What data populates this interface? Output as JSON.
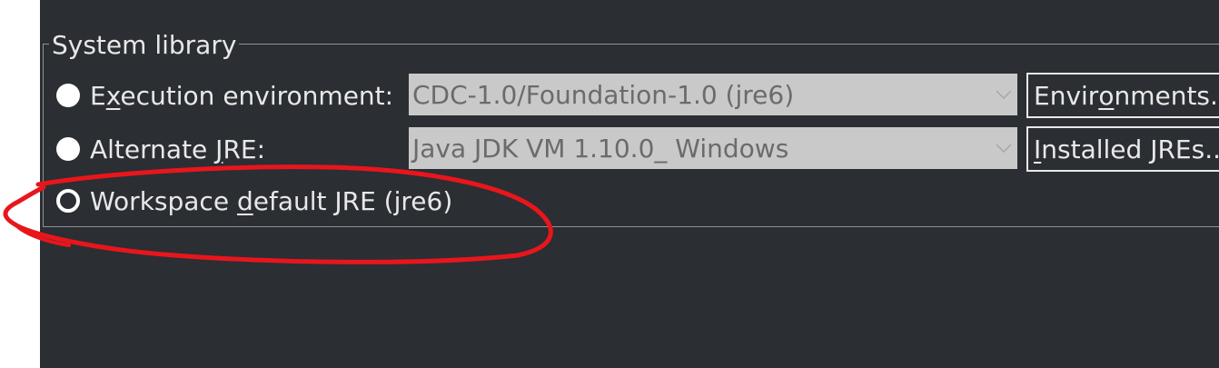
{
  "group": {
    "title": "System library"
  },
  "options": [
    {
      "label_pre": "E",
      "label_mnemonic": "x",
      "label_post": "ecution environment:",
      "selected": false
    },
    {
      "label_pre": "Alternate ",
      "label_mnemonic": "J",
      "label_post": "RE:",
      "selected": false
    },
    {
      "label_pre": "Workspace ",
      "label_mnemonic": "d",
      "label_post": "efault JRE (jre6)",
      "selected": true
    }
  ],
  "combos": {
    "execution_env": {
      "value": "CDC-1.0/Foundation-1.0 (jre6)",
      "enabled": false
    },
    "alternate_jre": {
      "value": "Java JDK VM 1.10.0_ Windows",
      "enabled": false
    }
  },
  "buttons": {
    "environments": {
      "pre": "Envir",
      "mnemonic": "o",
      "post": "nments..."
    },
    "installed_jres": {
      "pre": "",
      "mnemonic": "I",
      "post": "nstalled JREs..."
    }
  },
  "colors": {
    "background": "#2b2e33",
    "text": "#e8e8e8",
    "combo_disabled_bg": "#c9c9c9",
    "combo_disabled_text": "#6b6b6b",
    "annotation": "#e8161c"
  },
  "icons": {
    "combo_arrow": "chevron-down-icon"
  }
}
